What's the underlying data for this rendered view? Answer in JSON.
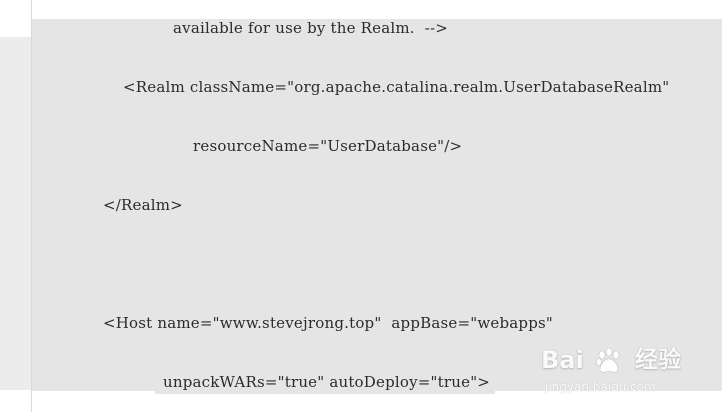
{
  "code_lines": [
    "available for use by the Realm.  -->",
    "<Realm className=\"org.apache.catalina.realm.UserDatabaseRealm\"",
    "resourceName=\"UserDatabase\"/>",
    "</Realm>",
    "<Host name=\"www.stevejrong.top\"  appBase=\"webapps\"",
    "unpackWARs=\"true\" autoDeploy=\"true\">"
  ],
  "watermark": {
    "brand": "Bai",
    "brand_suffix": "经验",
    "url": "jingyan.baidu.com",
    "icon": "baidu-paw-icon"
  },
  "colors": {
    "panel_bg": "#e5e5e5",
    "text": "#2b2b2b"
  }
}
